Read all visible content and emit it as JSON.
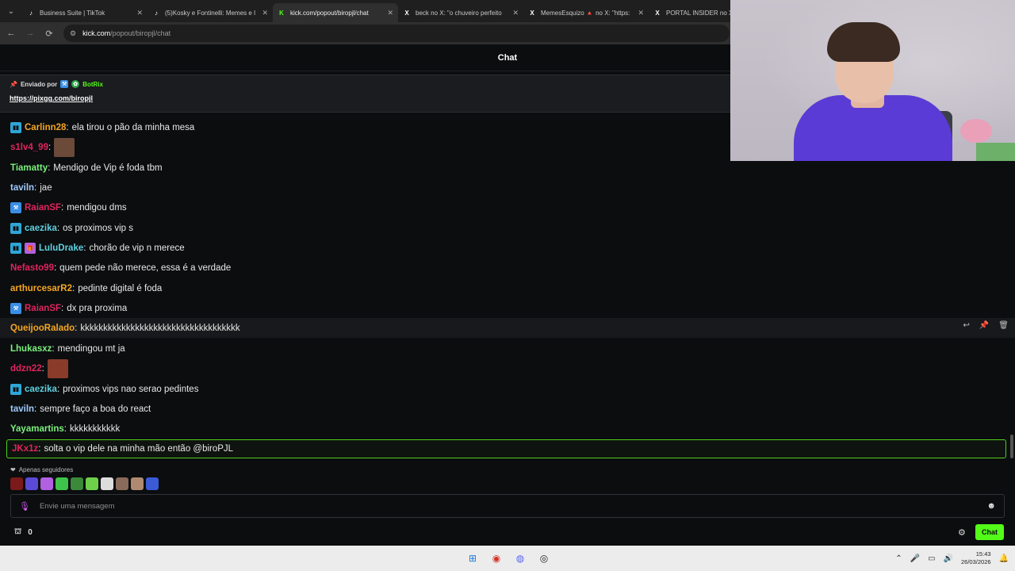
{
  "browser": {
    "tabs": [
      {
        "title": "Business Suite | TikTok",
        "icon": "tiktok-icon",
        "active": false
      },
      {
        "title": "(5)Kosky e Fontinelli: Memes e I",
        "icon": "tiktok-icon",
        "active": false
      },
      {
        "title": "kick.com/popout/biropjl/chat",
        "icon": "kick-icon",
        "active": true
      },
      {
        "title": "beck no X: \"o chuveiro perfeito",
        "icon": "x-icon",
        "active": false
      },
      {
        "title": "MemesEsquizo 🔺 no X: \"https:",
        "icon": "x-icon",
        "active": false
      },
      {
        "title": "PORTAL INSIDER no X:",
        "icon": "x-icon",
        "active": false
      }
    ],
    "url_host": "kick.com",
    "url_path": "/popout/biropjl/chat"
  },
  "chat": {
    "title": "Chat",
    "pinned": {
      "label": "Enviado por",
      "sender": "BotRix",
      "link": "https://pixgg.com/biropjl"
    },
    "messages": [
      {
        "badges": [
          "sub"
        ],
        "user": "Carlinn28",
        "color": "#f5a623",
        "text": "ela tirou o pão da minha mesa"
      },
      {
        "badges": [],
        "user": "s1lv4_99",
        "color": "#e0245e",
        "text": "",
        "emote": "#6b4a3a"
      },
      {
        "badges": [],
        "user": "Tiamatty",
        "color": "#7cf07c",
        "text": "Mendigo de Vip é foda tbm"
      },
      {
        "badges": [],
        "user": "taviln",
        "color": "#9ecbff",
        "text": "jae"
      },
      {
        "badges": [
          "mod"
        ],
        "user": "RaianSF",
        "color": "#e0245e",
        "text": "mendigou dms"
      },
      {
        "badges": [
          "sub"
        ],
        "user": "caezika",
        "color": "#5ed0e0",
        "text": "os proximos vip s"
      },
      {
        "badges": [
          "sub",
          "gift"
        ],
        "user": "LuluDrake",
        "color": "#5ed0e0",
        "text": "chorão de vip n merece"
      },
      {
        "badges": [],
        "user": "Nefasto99",
        "color": "#e0245e",
        "text": "quem pede não merece, essa é a verdade"
      },
      {
        "badges": [],
        "user": "arthurcesarR2",
        "color": "#f5a623",
        "text": "pedinte digital é foda"
      },
      {
        "badges": [
          "mod"
        ],
        "user": "RaianSF",
        "color": "#e0245e",
        "text": "dx pra proxima"
      },
      {
        "badges": [],
        "user": "QueijooRalado",
        "color": "#f5a623",
        "text": "kkkkkkkkkkkkkkkkkkkkkkkkkkkkkkkkkkk",
        "hover": true
      },
      {
        "badges": [],
        "user": "Lhukasxz",
        "color": "#7cf07c",
        "text": "mendingou mt ja"
      },
      {
        "badges": [],
        "user": "ddzn22",
        "color": "#e0245e",
        "text": "",
        "emote": "#8a3b2a"
      },
      {
        "badges": [
          "sub"
        ],
        "user": "caezika",
        "color": "#5ed0e0",
        "text": "proximos vips nao serao pedintes"
      },
      {
        "badges": [],
        "user": "taviln",
        "color": "#9ecbff",
        "text": "sempre faço a boa do react"
      },
      {
        "badges": [],
        "user": "Yayamartins",
        "color": "#7cf07c",
        "text": "kkkkkkkkkkk"
      },
      {
        "badges": [],
        "user": "JKx1z",
        "color": "#e0245e",
        "text": "solta o vip dele na minha mão então @biroPJL",
        "highlight": true
      }
    ],
    "followers_only": "Apenas seguidores",
    "input_placeholder": "Envie uma mensagem",
    "points": "0",
    "chat_button": "Chat"
  },
  "taskbar": {
    "time": "15:43",
    "date": "26/03/2026"
  }
}
